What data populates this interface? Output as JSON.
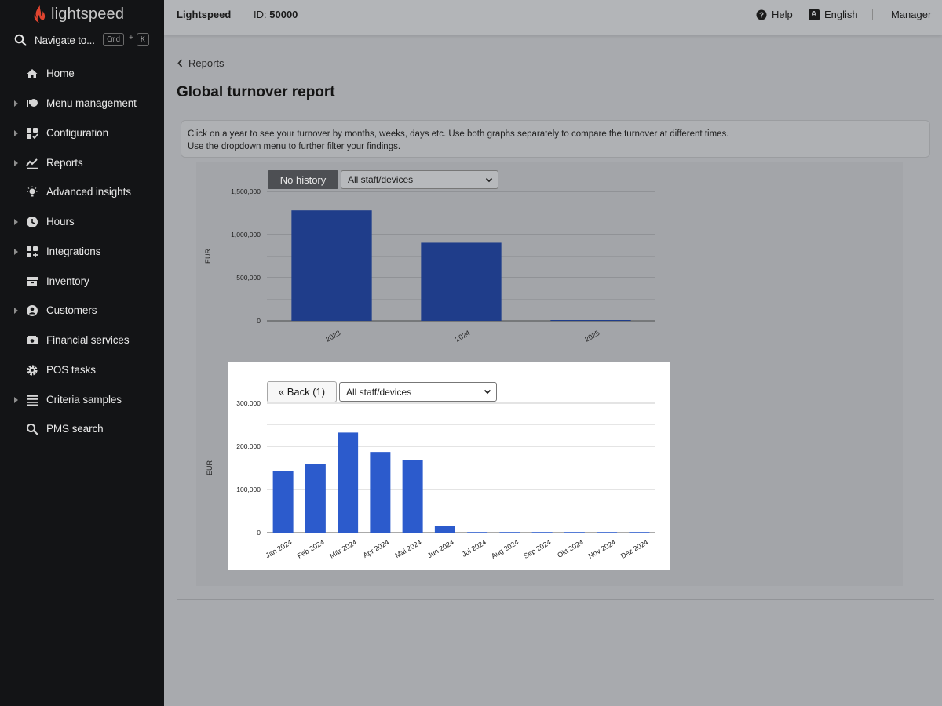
{
  "sidebar": {
    "logo_text": "lightspeed",
    "search": {
      "label": "Navigate to...",
      "shortcut_mod": "Cmd",
      "shortcut_plus": "+",
      "shortcut_key": "K"
    },
    "items": [
      {
        "label": "Home",
        "icon": "home-icon",
        "expandable": false
      },
      {
        "label": "Menu management",
        "icon": "menu-management-icon",
        "expandable": true
      },
      {
        "label": "Configuration",
        "icon": "configuration-icon",
        "expandable": true
      },
      {
        "label": "Reports",
        "icon": "reports-icon",
        "expandable": true
      },
      {
        "label": "Advanced insights",
        "icon": "lightbulb-icon",
        "expandable": false
      },
      {
        "label": "Hours",
        "icon": "clock-icon",
        "expandable": true
      },
      {
        "label": "Integrations",
        "icon": "integrations-icon",
        "expandable": true
      },
      {
        "label": "Inventory",
        "icon": "inventory-icon",
        "expandable": false
      },
      {
        "label": "Customers",
        "icon": "customers-icon",
        "expandable": true
      },
      {
        "label": "Financial services",
        "icon": "financial-services-icon",
        "expandable": false
      },
      {
        "label": "POS tasks",
        "icon": "gear-icon",
        "expandable": false
      },
      {
        "label": "Criteria samples",
        "icon": "list-icon",
        "expandable": true
      },
      {
        "label": "PMS search",
        "icon": "search-icon",
        "expandable": false
      }
    ]
  },
  "topbar": {
    "brand": "Lightspeed",
    "id_label": "ID:",
    "id_value": "50000",
    "help": "Help",
    "language_badge": "A",
    "language": "English",
    "user": "Manager"
  },
  "main": {
    "breadcrumb": "Reports",
    "title": "Global turnover report",
    "info_line1": "Click on a year to see your turnover by months, weeks, days etc. Use both graphs separately to compare the turnover at different times.",
    "info_line2": "Use the dropdown menu to further filter your findings.",
    "chart1_controls": {
      "history_button": "No history",
      "filter_value": "All staff/devices"
    },
    "chart2_controls": {
      "back_button": "« Back (1)",
      "filter_value": "All staff/devices"
    }
  },
  "colors": {
    "sidebar_bg": "#131416",
    "bar_yearly": "#1f3d8a",
    "bar_monthly": "#2c5bcc",
    "logo_red": "#e0442f"
  },
  "chart_data": [
    {
      "type": "bar",
      "categories": [
        "2023",
        "2024",
        "2025"
      ],
      "values": [
        1280000,
        905000,
        5000
      ],
      "ylabel": "EUR",
      "ylim": [
        0,
        1500000
      ],
      "yticks": [
        0,
        500000,
        1000000,
        1500000
      ],
      "ytick_labels": [
        "0",
        "500,000",
        "1,000,000",
        "1,500,000"
      ],
      "grid": true
    },
    {
      "type": "bar",
      "categories": [
        "Jan 2024",
        "Feb 2024",
        "Mär 2024",
        "Apr 2024",
        "Mai 2024",
        "Jun 2024",
        "Jul 2024",
        "Aug 2024",
        "Sep 2024",
        "Okt 2024",
        "Nov 2024",
        "Dez 2024"
      ],
      "values": [
        143000,
        159000,
        232000,
        187000,
        169000,
        15000,
        0,
        0,
        0,
        0,
        0,
        0
      ],
      "ylabel": "EUR",
      "ylim": [
        0,
        300000
      ],
      "yticks": [
        0,
        100000,
        200000,
        300000
      ],
      "ytick_labels": [
        "0",
        "100,000",
        "200,000",
        "300,000"
      ],
      "grid": true
    }
  ]
}
